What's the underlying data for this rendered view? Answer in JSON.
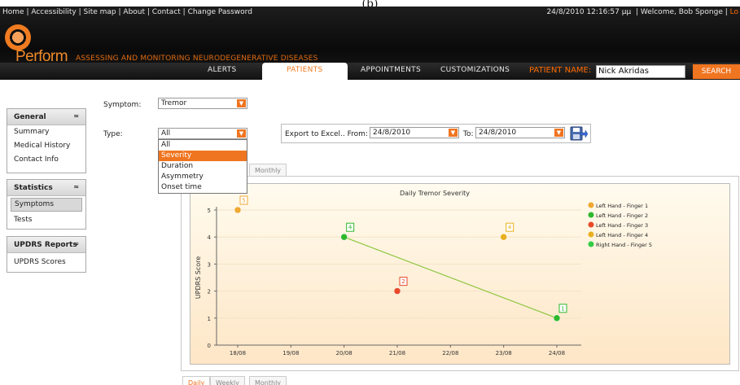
{
  "caption": "(b)",
  "toplinks": [
    "Home",
    "Accessibility",
    "Site map",
    "About",
    "Contact",
    "Change Password"
  ],
  "topright": {
    "datetime": "24/8/2010 12:16:57 μμ",
    "welcome": "Welcome, Bob Sponge",
    "logout": "Lo"
  },
  "brand": {
    "name": "Perform",
    "tagline": "ASSESSING AND MONITORING NEURODEGENERATIVE DISEASES"
  },
  "nav": {
    "items": [
      "ALERTS",
      "PATIENTS",
      "APPOINTMENTS",
      "CUSTOMIZATIONS"
    ],
    "active": "PATIENTS",
    "patient_label": "PATIENT NAME:",
    "patient_value": "Nick Akridas",
    "search": "SEARCH"
  },
  "sidebar": {
    "general": {
      "title": "General",
      "items": [
        "Summary",
        "Medical History",
        "Contact Info"
      ]
    },
    "statistics": {
      "title": "Statistics",
      "items": [
        "Symptoms",
        "Tests"
      ],
      "selected": "Symptoms"
    },
    "updrs": {
      "title": "UPDRS Reports",
      "items": [
        "UPDRS Scores"
      ]
    }
  },
  "filters": {
    "symptom_label": "Symptom:",
    "symptom_value": "Tremor",
    "type_label": "Type:",
    "type_value": "All",
    "type_options": [
      "All",
      "Severity",
      "Duration",
      "Asymmetry",
      "Onset time"
    ],
    "type_highlight": "Severity"
  },
  "export": {
    "label": "Export to Excel.. From:",
    "from": "24/8/2010",
    "to_label": "To:",
    "to": "24/8/2010"
  },
  "tabs": [
    "Daily",
    "Weekly",
    "Monthly"
  ],
  "tabs_active": "Daily",
  "colors": {
    "accent": "#f07520",
    "series": [
      "#f0a830",
      "#2eb82e",
      "#e84a2a",
      "#e8b020",
      "#33cc44"
    ]
  },
  "chart_data": {
    "type": "scatter",
    "title": "Daily Tremor Severity",
    "xlabel": "",
    "ylabel": "UPDRS Score",
    "categories": [
      "18/08",
      "19/08",
      "20/08",
      "21/08",
      "22/08",
      "23/08",
      "24/08"
    ],
    "ylim": [
      0,
      5
    ],
    "yticks": [
      0,
      1,
      2,
      3,
      4,
      5
    ],
    "legend_position": "top-right",
    "series": [
      {
        "name": "Left Hand - Finger 1",
        "points": [
          {
            "x": "18/08",
            "y": 5
          }
        ]
      },
      {
        "name": "Left Hand - Finger 2",
        "points": [
          {
            "x": "20/08",
            "y": 4
          },
          {
            "x": "24/08",
            "y": 1
          }
        ],
        "connected": true
      },
      {
        "name": "Left Hand - Finger 3",
        "points": [
          {
            "x": "21/08",
            "y": 2
          }
        ]
      },
      {
        "name": "Left Hand - Finger 4",
        "points": [
          {
            "x": "23/08",
            "y": 4
          }
        ]
      },
      {
        "name": "Right Hand - Finger 5",
        "points": []
      }
    ]
  }
}
